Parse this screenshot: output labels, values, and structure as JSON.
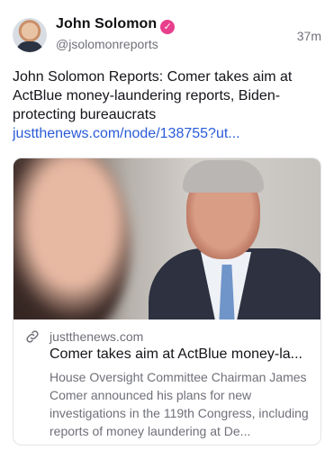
{
  "author": {
    "name": "John Solomon",
    "handle": "@jsolomonreports",
    "verified_icon": "verified-badge-icon",
    "verified_glyph": "✓",
    "verified_color": "#e83e8c"
  },
  "timestamp": "37m",
  "post": {
    "text": "John Solomon Reports: Comer takes aim at ActBlue money-laundering reports, Biden-protecting bureaucrats",
    "link_text": "justthenews.com/node/138755?ut..."
  },
  "card": {
    "domain": "justthenews.com",
    "title": "Comer takes aim at ActBlue money-la...",
    "description": "House Oversight Committee Chairman James Comer announced his plans for new investigations in the 119th Congress, including reports of money laundering at De...",
    "link_icon": "link-icon"
  },
  "colors": {
    "link": "#2a5bd7",
    "secondary_text": "#6f7079"
  }
}
